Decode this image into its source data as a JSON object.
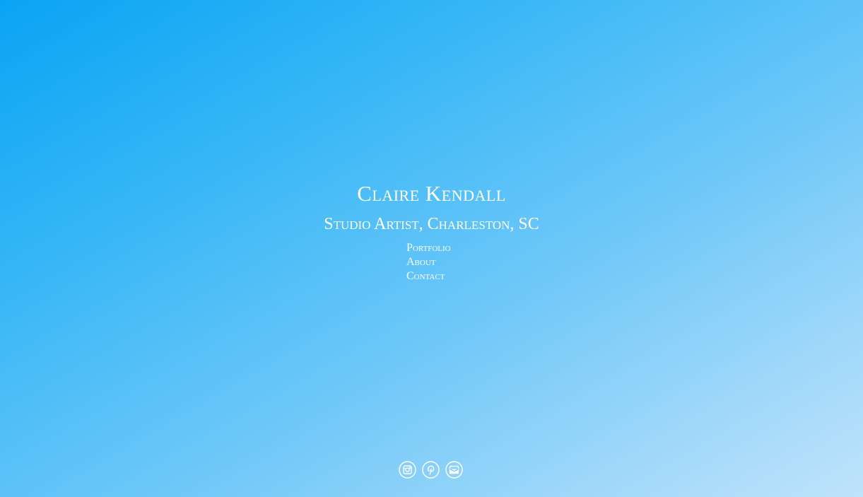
{
  "site": {
    "name": "Claire Kendall",
    "tagline": "Studio Artist, Charleston, SC"
  },
  "nav": {
    "items": [
      {
        "label": "Portfolio"
      },
      {
        "label": "About"
      },
      {
        "label": "Contact"
      }
    ]
  },
  "social": {
    "icons": [
      "instagram-icon",
      "pinterest-icon",
      "email-icon"
    ]
  },
  "colors": {
    "gradient_start": "#0aa4f4",
    "gradient_end": "#bfe3fb",
    "text": "#ffffff"
  }
}
